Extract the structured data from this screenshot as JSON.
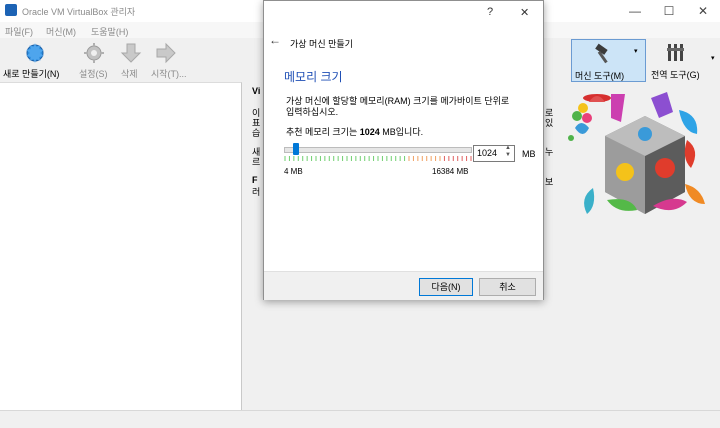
{
  "window": {
    "title": "Oracle VM VirtualBox 관리자",
    "minimize_glyph": "—",
    "maximize_glyph": "☐",
    "close_glyph": "✕"
  },
  "menu": [
    "파일(F)",
    "머신(M)",
    "도움말(H)"
  ],
  "toolbar": {
    "new_label": "새로 만들기(N)",
    "settings_label": "설정(S)",
    "discard_label": "삭제",
    "start_label": "시작(T)...",
    "machine_tools_label": "머신 도구(M)",
    "global_tools_label": "전역 도구(G)"
  },
  "right_pane_fragments": {
    "frag_vi": "Vi",
    "frag_1": "이",
    "frag_2": "표",
    "frag_3": "습",
    "frag_4": "새",
    "frag_5": "르",
    "frag_6": "F",
    "frag_7": "러",
    "frag_right1": "로",
    "frag_right2": "있",
    "frag_right3": "누",
    "frag_right4": "보"
  },
  "dialog": {
    "help_glyph": "?",
    "close_glyph": "✕",
    "back_glyph": "←",
    "header": "가상 머신 만들기",
    "section_title": "메모리 크기",
    "description_line1": "가상 머신에 할당할 메모리(RAM) 크기를 메가바이트 단위로",
    "description_line2": "입력하십시오.",
    "recommend_prefix": "추천 메모리 크기는 ",
    "recommend_value": "1024",
    "recommend_suffix": " MB입니다.",
    "slider_min_label": "4 MB",
    "slider_max_label": "16384 MB",
    "memory_value": "1024",
    "memory_unit": "MB",
    "slider_fraction": 0.0625,
    "next_label": "다음(N)",
    "cancel_label": "취소"
  }
}
